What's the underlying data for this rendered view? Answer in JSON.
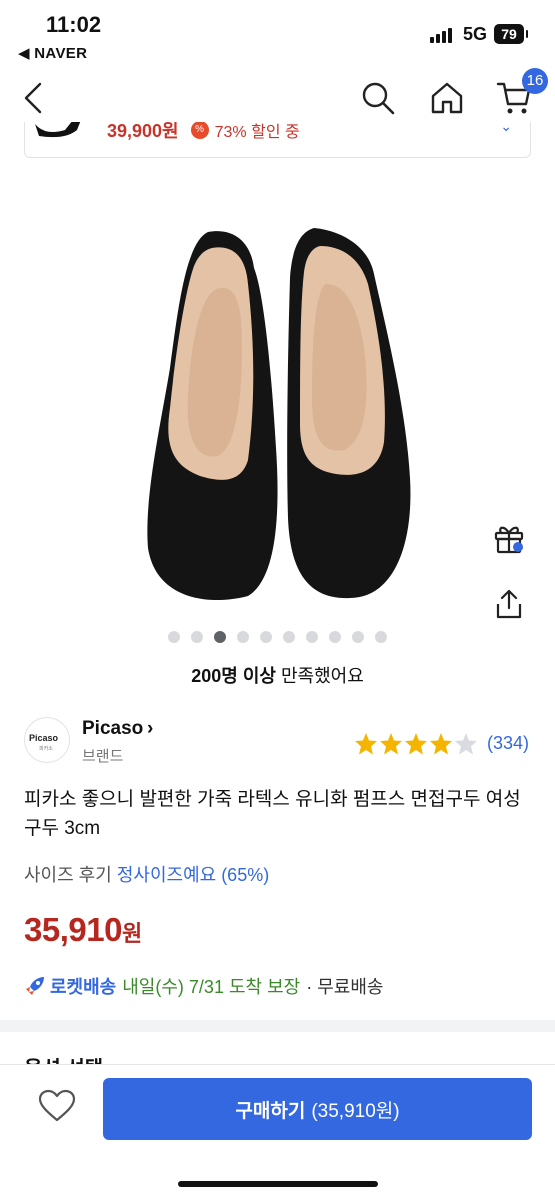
{
  "status_bar": {
    "time": "11:02",
    "back_app": "◀ NAVER",
    "network": "5G",
    "battery": "79"
  },
  "nav": {
    "cart_count": "16",
    "back_icon": "chevron-left-icon",
    "search_icon": "search-icon",
    "home_icon": "home-icon",
    "cart_icon": "cart-icon"
  },
  "promo": {
    "price": "39,900원",
    "discount": "73% 할인 중"
  },
  "gallery": {
    "dot_count": 10,
    "active_index": 2
  },
  "satisfaction": {
    "count": "200명 이상",
    "text": " 만족했어요"
  },
  "brand": {
    "logo_text": "Picaso",
    "logo_sub": "피카소",
    "name": "Picaso",
    "chevron": "›",
    "label": "브랜드"
  },
  "rating": {
    "stars": 4,
    "max": 5,
    "review_count": "(334)"
  },
  "product": {
    "title": "피카소 좋으니 발편한 가죽 라텍스 유니화 펌프스 면접구두 여성구두 3cm",
    "size_review_label": "사이즈 후기",
    "size_review_value": "정사이즈예요 (65%)",
    "price": "35,910",
    "price_unit": "원"
  },
  "delivery": {
    "rocket": "로켓배송",
    "date": "내일(수) 7/31 도착 보장",
    "free": "· 무료배송"
  },
  "options": {
    "title": "옵션 선택"
  },
  "bottom_bar": {
    "buy_label": "구매하기",
    "buy_price": "(35,910원)"
  },
  "colors": {
    "accent": "#3468e0",
    "price_red": "#b5271f",
    "delivery_green": "#3a8a2a",
    "star": "#f4b400"
  }
}
